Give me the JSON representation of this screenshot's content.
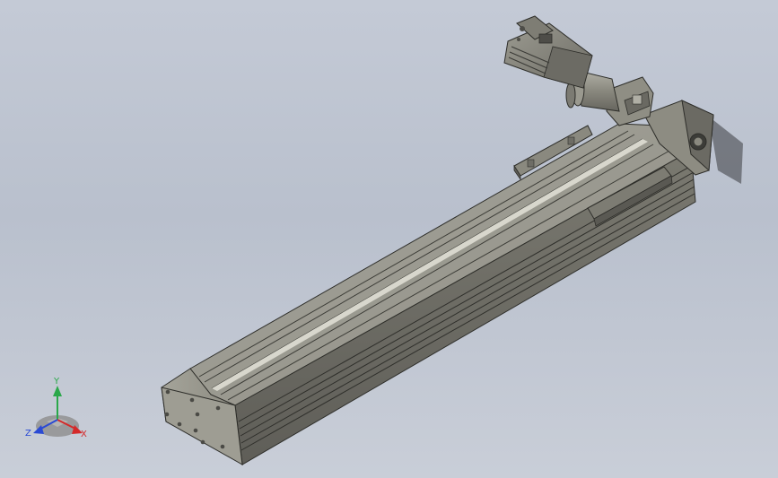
{
  "viewport": {
    "background_top": "#c4cad6",
    "background_bottom": "#c9ced8"
  },
  "model": {
    "body_color": "#8f8e84",
    "body_dark": "#6e6d66",
    "body_light": "#b8b7ad",
    "edge_color": "#2e2e2a"
  },
  "triad": {
    "x_label": "X",
    "y_label": "Y",
    "z_label": "Z",
    "x_color": "#d42a2a",
    "y_color": "#2aa84a",
    "z_color": "#2a4ad4"
  }
}
